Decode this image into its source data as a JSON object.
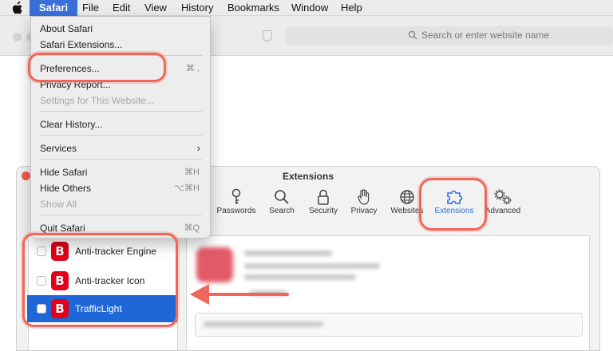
{
  "colors": {
    "accent": "#1f66d6",
    "menubar_highlight": "#3a6fd8",
    "annotation": "#f0665c",
    "brand_red": "#e2001a"
  },
  "menubar": {
    "apple_icon": "apple-icon",
    "items": [
      {
        "label": "Safari"
      },
      {
        "label": "File"
      },
      {
        "label": "Edit"
      },
      {
        "label": "View"
      },
      {
        "label": "History"
      },
      {
        "label": "Bookmarks"
      },
      {
        "label": "Window"
      },
      {
        "label": "Help"
      }
    ]
  },
  "browser": {
    "search_placeholder": "Search or enter website name"
  },
  "safari_menu": {
    "items": [
      {
        "label": "About Safari",
        "shortcut": "",
        "enabled": true
      },
      {
        "label": "Safari Extensions...",
        "shortcut": "",
        "enabled": true
      },
      {
        "label": "Preferences...",
        "shortcut": "⌘ ,",
        "enabled": true
      },
      {
        "label": "Privacy Report...",
        "shortcut": "",
        "enabled": true
      },
      {
        "label": "Settings for This Website...",
        "shortcut": "",
        "enabled": false
      },
      {
        "label": "Clear History...",
        "shortcut": "",
        "enabled": true
      },
      {
        "label": "Services",
        "shortcut": "›",
        "enabled": true
      },
      {
        "label": "Hide Safari",
        "shortcut": "⌘H",
        "enabled": true
      },
      {
        "label": "Hide Others",
        "shortcut": "⌥⌘H",
        "enabled": true
      },
      {
        "label": "Show All",
        "shortcut": "",
        "enabled": false
      },
      {
        "label": "Quit Safari",
        "shortcut": "⌘Q",
        "enabled": true
      }
    ]
  },
  "prefs": {
    "title": "Extensions",
    "toolbar": [
      {
        "label": "Passwords",
        "icon": "key-icon"
      },
      {
        "label": "Search",
        "icon": "search-icon"
      },
      {
        "label": "Security",
        "icon": "lock-icon"
      },
      {
        "label": "Privacy",
        "icon": "hand-icon"
      },
      {
        "label": "Websites",
        "icon": "globe-icon"
      },
      {
        "label": "Extensions",
        "icon": "puzzle-icon",
        "selected": true
      },
      {
        "label": "Advanced",
        "icon": "gears-icon"
      }
    ],
    "extensions": [
      {
        "name": "Anti-tracker Engine",
        "icon_letter": "B",
        "checked": false,
        "selected": false
      },
      {
        "name": "Anti-tracker Icon",
        "icon_letter": "B",
        "checked": false,
        "selected": false
      },
      {
        "name": "TrafficLight",
        "icon_letter": "B",
        "checked": false,
        "selected": true
      }
    ]
  }
}
